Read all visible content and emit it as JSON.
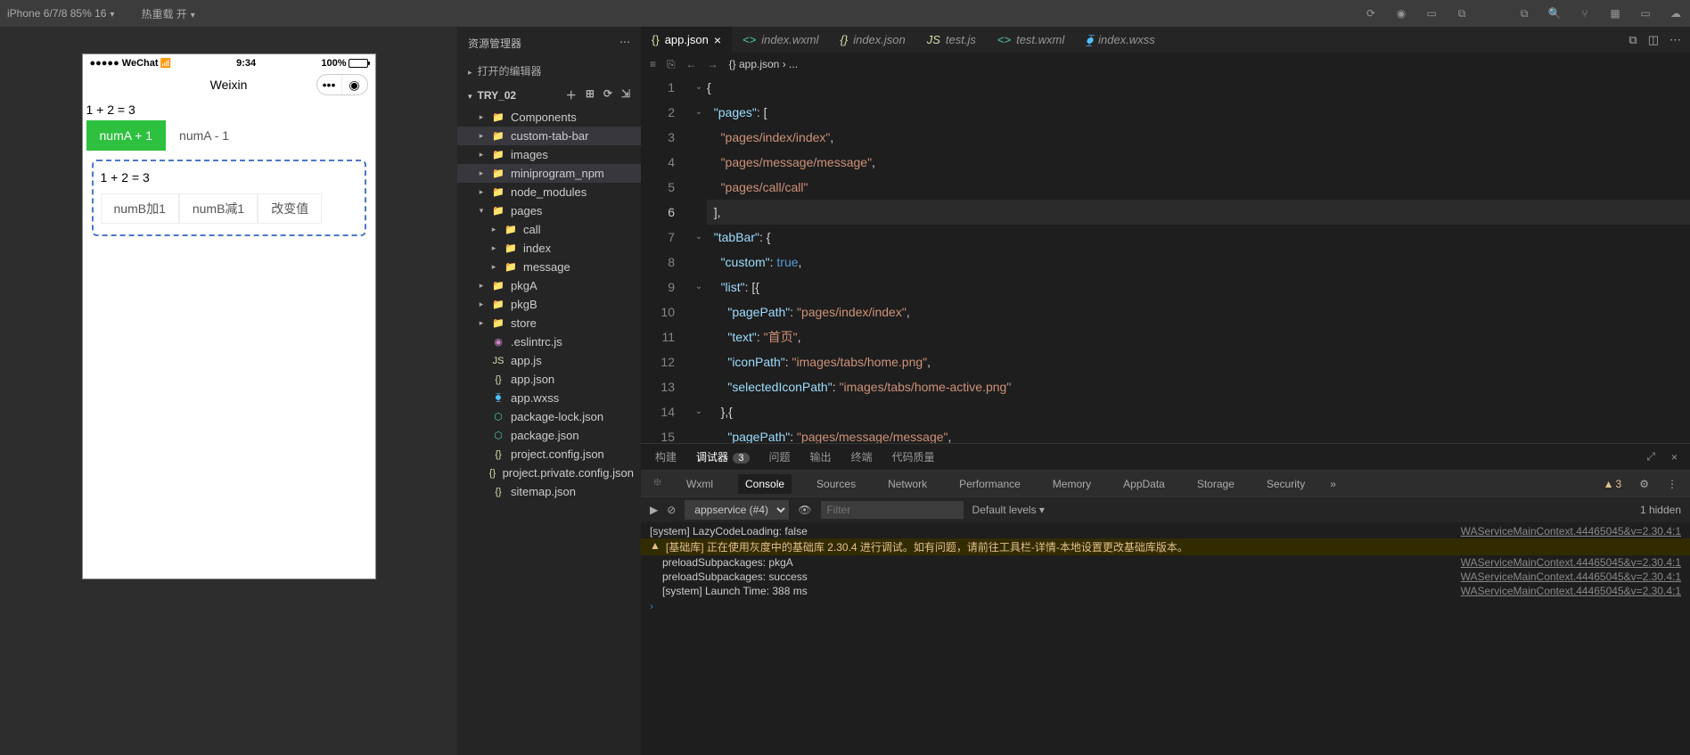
{
  "topbar": {
    "device": "iPhone 6/7/8 85% 16",
    "reload": "热重载 开"
  },
  "simulator": {
    "carrier": "●●●●● WeChat",
    "time": "9:34",
    "battery": "100%",
    "title": "Weixin",
    "eq1": "1 + 2 = 3",
    "btn_numA_plus": "numA + 1",
    "btn_numA_minus": "numA - 1",
    "eq2": "1 + 2 = 3",
    "btn_numB_plus": "numB加1",
    "btn_numB_minus": "numB减1",
    "btn_change": "改变值"
  },
  "explorer": {
    "title": "资源管理器",
    "open_editors": "打开的编辑器",
    "project": "TRY_02",
    "tree": {
      "components": "Components",
      "custom_tab_bar": "custom-tab-bar",
      "images": "images",
      "miniprogram_npm": "miniprogram_npm",
      "node_modules": "node_modules",
      "pages": "pages",
      "call": "call",
      "index": "index",
      "message": "message",
      "pkgA": "pkgA",
      "pkgB": "pkgB",
      "store": "store",
      "eslintrc": ".eslintrc.js",
      "appjs": "app.js",
      "appjson": "app.json",
      "appwxss": "app.wxss",
      "package_lock": "package-lock.json",
      "package": "package.json",
      "project_config": "project.config.json",
      "project_private": "project.private.config.json",
      "sitemap": "sitemap.json"
    }
  },
  "tabs": {
    "appjson": "app.json",
    "indexwxml": "index.wxml",
    "indexjson": "index.json",
    "testjs": "test.js",
    "testwxml": "test.wxml",
    "indexwxss": "index.wxss"
  },
  "breadcrumb": {
    "file": "app.json",
    "rest": "› ..."
  },
  "code": {
    "l1": "{",
    "l2_key": "\"pages\"",
    "l2_rest": ": [",
    "l3": "\"pages/index/index\"",
    "l4": "\"pages/message/message\"",
    "l5": "\"pages/call/call\"",
    "l6": "],",
    "l7_key": "\"tabBar\"",
    "l7_rest": ": {",
    "l8_key": "\"custom\"",
    "l8_val": "true",
    "l9_key": "\"list\"",
    "l9_rest": ": [{",
    "l10_key": "\"pagePath\"",
    "l10_val": "\"pages/index/index\"",
    "l11_key": "\"text\"",
    "l11_val": "\"首页\"",
    "l12_key": "\"iconPath\"",
    "l12_val": "\"images/tabs/home.png\"",
    "l13_key": "\"selectedIconPath\"",
    "l13_val": "\"images/tabs/home-active.png\"",
    "l14": "},{",
    "l15_key": "\"pagePath\"",
    "l15_val": "\"pages/message/message\""
  },
  "panel_tabs": {
    "build": "构建",
    "debugger": "调试器",
    "debugger_badge": "3",
    "problems": "问题",
    "output": "输出",
    "terminal": "终端",
    "quality": "代码质量"
  },
  "devtools_tabs": {
    "wxml": "Wxml",
    "console": "Console",
    "sources": "Sources",
    "network": "Network",
    "performance": "Performance",
    "memory": "Memory",
    "appdata": "AppData",
    "storage": "Storage",
    "security": "Security",
    "warn_count": "3"
  },
  "console_ctrl": {
    "context": "appservice (#4)",
    "filter_placeholder": "Filter",
    "levels": "Default levels",
    "hidden": "1 hidden"
  },
  "console": {
    "r0_msg": "[system] LazyCodeLoading: false",
    "r0_src": "WAServiceMainContext.44465045&v=2.30.4:1",
    "r1_msg": "[基础库] 正在使用灰度中的基础库 2.30.4 进行调试。如有问题，请前往工具栏-详情-本地设置更改基础库版本。",
    "r2_msg": "preloadSubpackages: pkgA",
    "r2_src": "WAServiceMainContext.44465045&v=2.30.4:1",
    "r3_msg": "preloadSubpackages: success",
    "r3_src": "WAServiceMainContext.44465045&v=2.30.4:1",
    "r4_msg": "[system] Launch Time: 388 ms",
    "r4_src": "WAServiceMainContext.44465045&v=2.30.4:1"
  }
}
